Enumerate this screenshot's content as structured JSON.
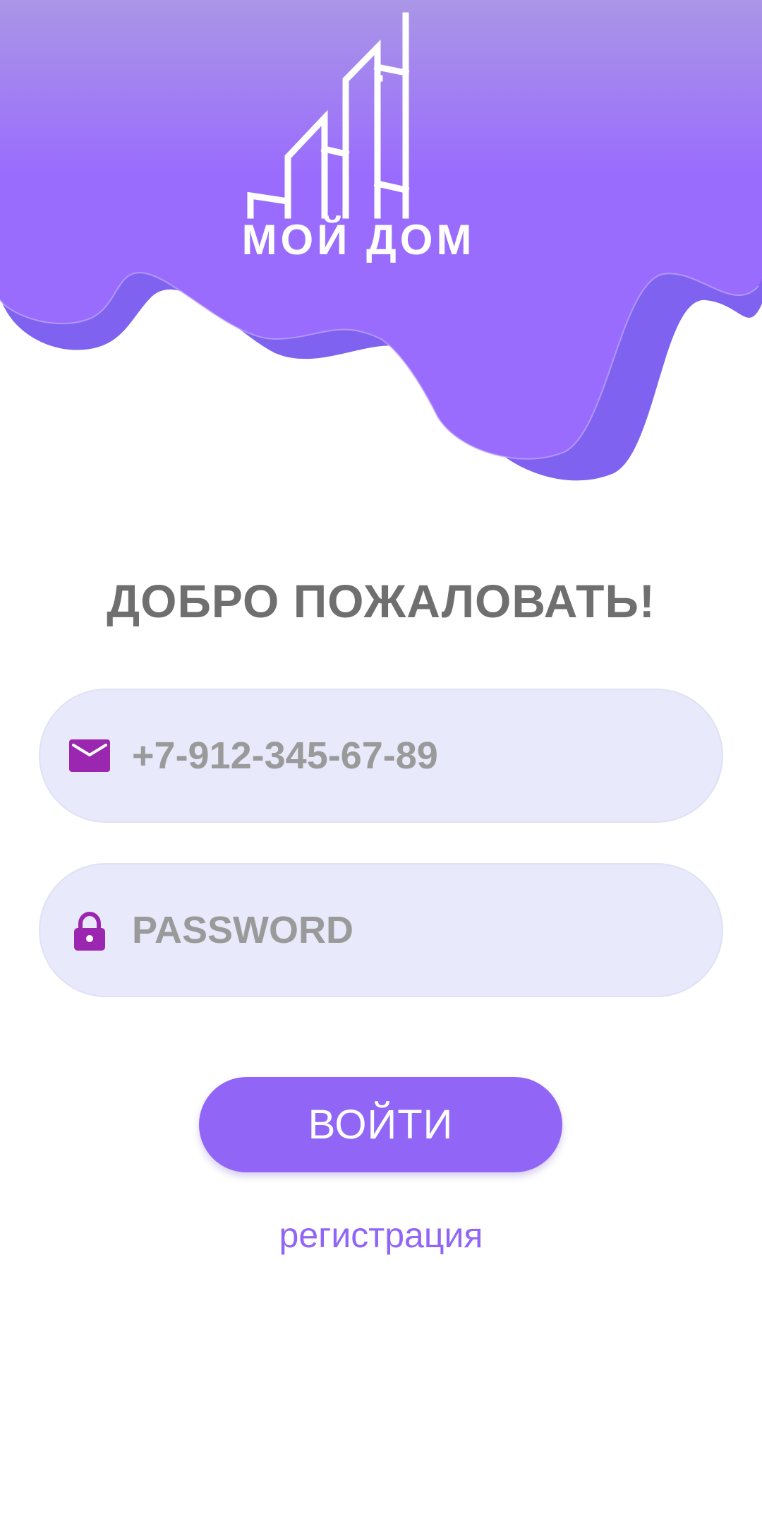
{
  "header": {
    "brand_name": "МОЙ ДОМ",
    "logo_icon": "city-buildings-icon",
    "colors": {
      "gradient_top": "#aa96e6",
      "gradient_mid": "#9a6cfd",
      "wave_shadow": "#7f63f0"
    }
  },
  "main": {
    "welcome_title": "ДОБРО ПОЖАЛОВАТЬ!"
  },
  "form": {
    "phone": {
      "placeholder": "+7-912-345-67-89",
      "icon": "mail-icon"
    },
    "password": {
      "placeholder": "PASSWORD",
      "icon": "lock-icon"
    },
    "login_button_label": "ВОЙТИ",
    "register_link_label": "регистрация"
  },
  "colors": {
    "accent": "#9166f7",
    "icon": "#9b27b0",
    "field_background": "#e8e9fa",
    "title_text": "#6f6f6f",
    "placeholder_text": "#9a9a9a"
  }
}
